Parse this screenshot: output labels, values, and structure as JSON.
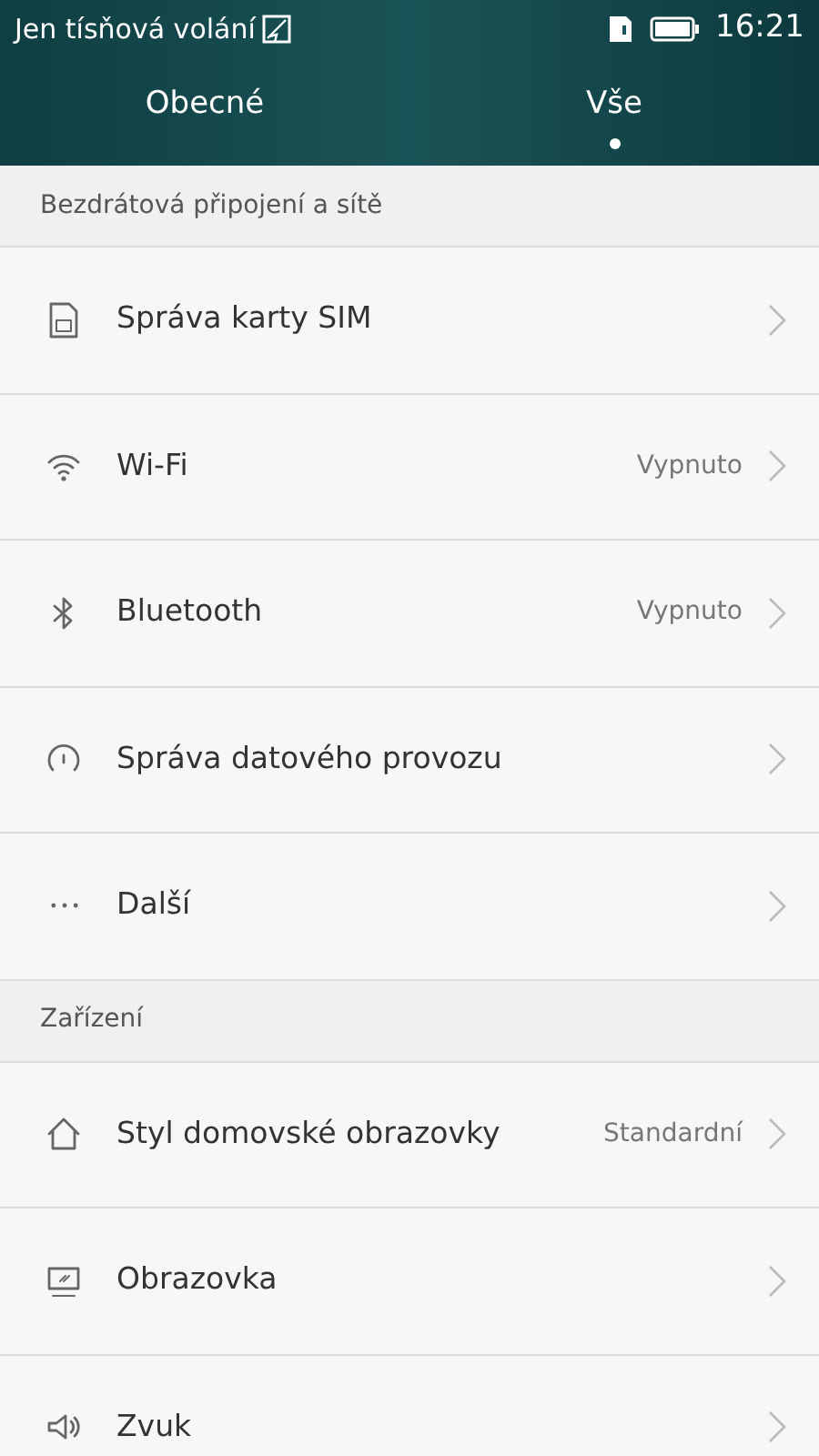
{
  "status_bar": {
    "carrier": "Jen tísňová volání",
    "time": "16:21"
  },
  "tabs": [
    {
      "label": "Obecné",
      "selected": false
    },
    {
      "label": "Vše",
      "selected": true
    }
  ],
  "sections": [
    {
      "title": "Bezdrátová připojení a sítě",
      "items": [
        {
          "kind": "sim",
          "label": "Správa karty SIM"
        },
        {
          "kind": "wifi",
          "label": "Wi-Fi",
          "value": "Vypnuto"
        },
        {
          "kind": "bluetooth",
          "label": "Bluetooth",
          "value": "Vypnuto"
        },
        {
          "kind": "gauge",
          "label": "Správa datového provozu"
        },
        {
          "kind": "more",
          "label": "Další"
        }
      ]
    },
    {
      "title": "Zařízení",
      "items": [
        {
          "kind": "home",
          "label": "Styl domovské obrazovky",
          "value": "Standardní"
        },
        {
          "kind": "display",
          "label": "Obrazovka"
        },
        {
          "kind": "sound",
          "label": "Zvuk"
        }
      ]
    }
  ]
}
